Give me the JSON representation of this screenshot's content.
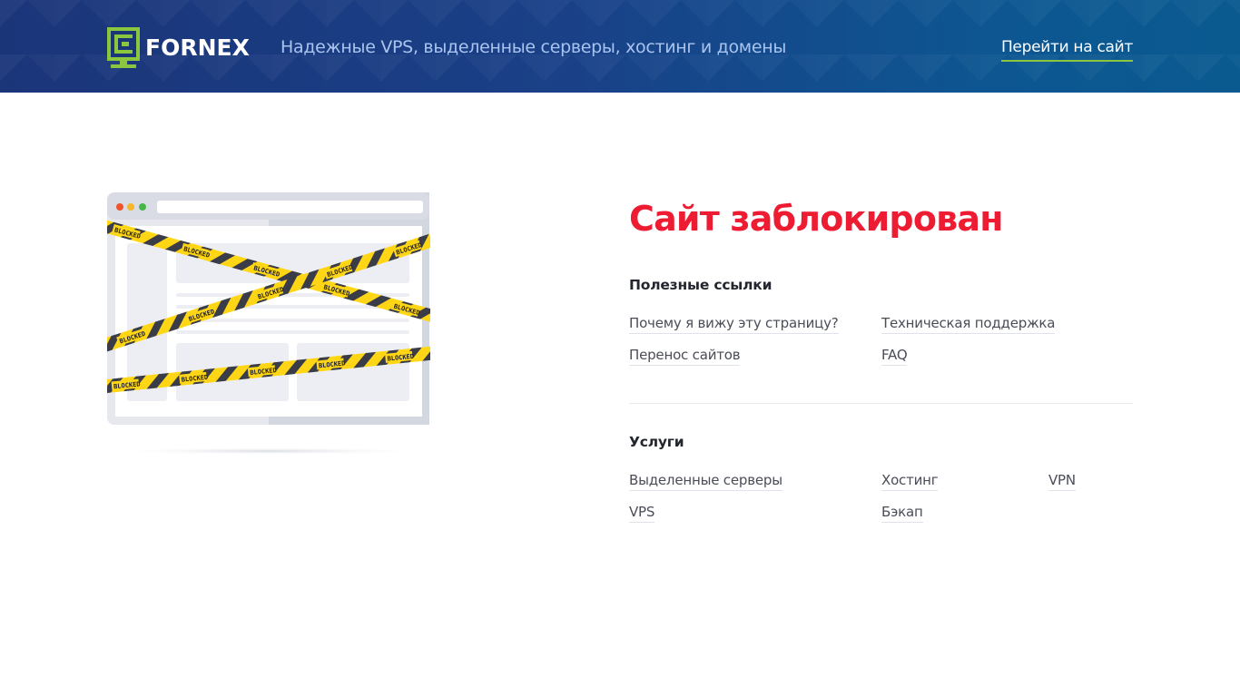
{
  "header": {
    "logo_text": "FORNEX",
    "tagline": "Надежные VPS, выделенные серверы, хостинг и домены",
    "goto_link": "Перейти на сайт"
  },
  "illustration": {
    "tape_label": "BLOCKED"
  },
  "main": {
    "title": "Сайт заблокирован",
    "useful_links": {
      "heading": "Полезные ссылки",
      "items": [
        "Почему я вижу эту страницу?",
        "Техническая поддержка",
        "Перенос сайтов",
        "FAQ"
      ]
    },
    "services": {
      "heading": "Услуги",
      "items": [
        "Выделенные серверы",
        "Хостинг",
        "VPN",
        "VPS",
        "Бэкап"
      ]
    }
  },
  "colors": {
    "brand_green": "#8cc63f",
    "header_blue": "#1b3579",
    "title_red": "#ee1c33",
    "tape_yellow": "#ffd615"
  }
}
